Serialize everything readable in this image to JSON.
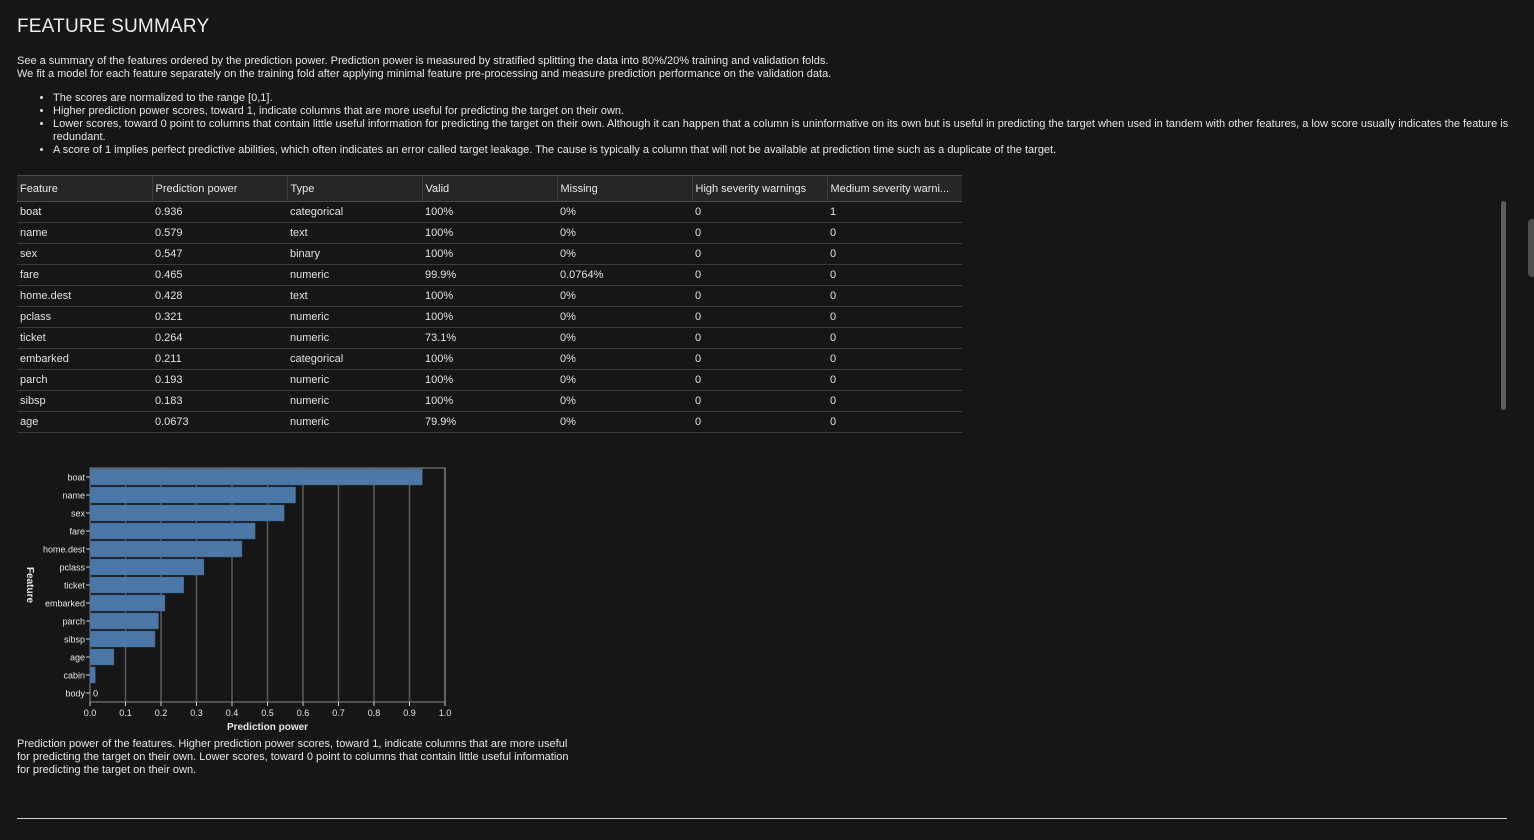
{
  "title": "FEATURE SUMMARY",
  "description": [
    "See a summary of the features ordered by the prediction power. Prediction power is measured by stratified splitting the data into 80%/20% training and validation folds.",
    "We fit a model for each feature separately on the training fold after applying minimal feature pre-processing and measure prediction performance on the validation data."
  ],
  "bullets": [
    "The scores are normalized to the range [0,1].",
    "Higher prediction power scores, toward 1, indicate columns that are more useful for predicting the target on their own.",
    "Lower scores, toward 0 point to columns that contain little useful information for predicting the target on their own. Although it can happen that a column is uninformative on its own but is useful in predicting the target when used in tandem with other features, a low score usually indicates the feature is redundant.",
    "A score of 1 implies perfect predictive abilities, which often indicates an error called target leakage. The cause is typically a column that will not be available at prediction time such as a duplicate of the target."
  ],
  "table": {
    "columns": [
      "Feature",
      "Prediction power",
      "Type",
      "Valid",
      "Missing",
      "High severity warnings",
      "Medium severity warni..."
    ],
    "rows": [
      [
        "boat",
        "0.936",
        "categorical",
        "100%",
        "0%",
        "0",
        "1"
      ],
      [
        "name",
        "0.579",
        "text",
        "100%",
        "0%",
        "0",
        "0"
      ],
      [
        "sex",
        "0.547",
        "binary",
        "100%",
        "0%",
        "0",
        "0"
      ],
      [
        "fare",
        "0.465",
        "numeric",
        "99.9%",
        "0.0764%",
        "0",
        "0"
      ],
      [
        "home.dest",
        "0.428",
        "text",
        "100%",
        "0%",
        "0",
        "0"
      ],
      [
        "pclass",
        "0.321",
        "numeric",
        "100%",
        "0%",
        "0",
        "0"
      ],
      [
        "ticket",
        "0.264",
        "numeric",
        "73.1%",
        "0%",
        "0",
        "0"
      ],
      [
        "embarked",
        "0.211",
        "categorical",
        "100%",
        "0%",
        "0",
        "0"
      ],
      [
        "parch",
        "0.193",
        "numeric",
        "100%",
        "0%",
        "0",
        "0"
      ],
      [
        "sibsp",
        "0.183",
        "numeric",
        "100%",
        "0%",
        "0",
        "0"
      ],
      [
        "age",
        "0.0673",
        "numeric",
        "79.9%",
        "0%",
        "0",
        "0"
      ]
    ]
  },
  "chart_data": {
    "type": "bar",
    "orientation": "horizontal",
    "categories": [
      "boat",
      "name",
      "sex",
      "fare",
      "home.dest",
      "pclass",
      "ticket",
      "embarked",
      "parch",
      "sibsp",
      "age",
      "cabin",
      "body"
    ],
    "values": [
      0.936,
      0.579,
      0.547,
      0.465,
      0.428,
      0.321,
      0.264,
      0.211,
      0.193,
      0.183,
      0.0673,
      0.015,
      0
    ],
    "value_labels": [
      "",
      "",
      "",
      "",
      "",
      "",
      "",
      "",
      "",
      "",
      "",
      "",
      "0"
    ],
    "xlabel": "Prediction power",
    "ylabel": "Feature",
    "xlim": [
      0,
      1.0
    ],
    "xticks": [
      "0.0",
      "0.1",
      "0.2",
      "0.3",
      "0.4",
      "0.5",
      "0.6",
      "0.7",
      "0.8",
      "0.9",
      "1.0"
    ],
    "grid": true,
    "bar_color": "#4c78a8"
  },
  "caption": "Prediction power of the features. Higher prediction power scores, toward 1, indicate columns that are more useful for predicting the target on their own. Lower scores, toward 0 point to columns that contain little useful information for predicting the target on their own."
}
